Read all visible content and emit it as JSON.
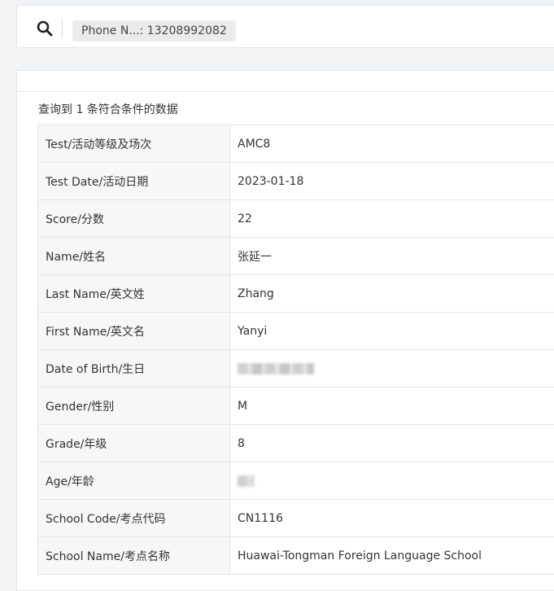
{
  "search": {
    "icon": "search-icon",
    "chip_label": "Phone N...: 13208992082"
  },
  "results": {
    "summary": "查询到 1 条符合条件的数据",
    "rows": [
      {
        "label": "Test/活动等级及场次",
        "value": "AMC8"
      },
      {
        "label": "Test Date/活动日期",
        "value": "2023-01-18"
      },
      {
        "label": "Score/分数",
        "value": "22"
      },
      {
        "label": "Name/姓名",
        "value": "张延一"
      },
      {
        "label": "Last Name/英文姓",
        "value": "Zhang"
      },
      {
        "label": "First Name/英文名",
        "value": "Yanyi"
      },
      {
        "label": "Date of Birth/生日",
        "value": null,
        "redacted": true
      },
      {
        "label": "Gender/性别",
        "value": "M"
      },
      {
        "label": "Grade/年级",
        "value": "8"
      },
      {
        "label": "Age/年龄",
        "value": null,
        "redacted": true
      },
      {
        "label": "School Code/考点代码",
        "value": "CN1116"
      },
      {
        "label": "School Name/考点名称",
        "value": "Huawai-Tongman Foreign Language School"
      }
    ]
  }
}
